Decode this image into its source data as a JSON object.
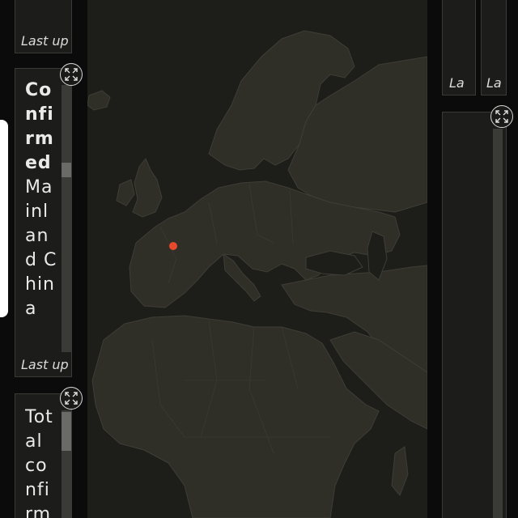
{
  "panels": {
    "top_left": {
      "footer": "Last up"
    },
    "confirmed": {
      "title": "Confirmed",
      "region": "Mainland China",
      "footer": "Last up"
    },
    "total": {
      "title": "Total confirmed"
    },
    "right_small_a": {
      "footer": "La"
    },
    "right_small_b": {
      "footer": "La"
    }
  },
  "map": {
    "land_color": "#2f2f28",
    "ocean_color": "#1d1d19",
    "marker_color": "#e8482c"
  },
  "icons": {
    "expand": "expand-arrows-icon"
  }
}
